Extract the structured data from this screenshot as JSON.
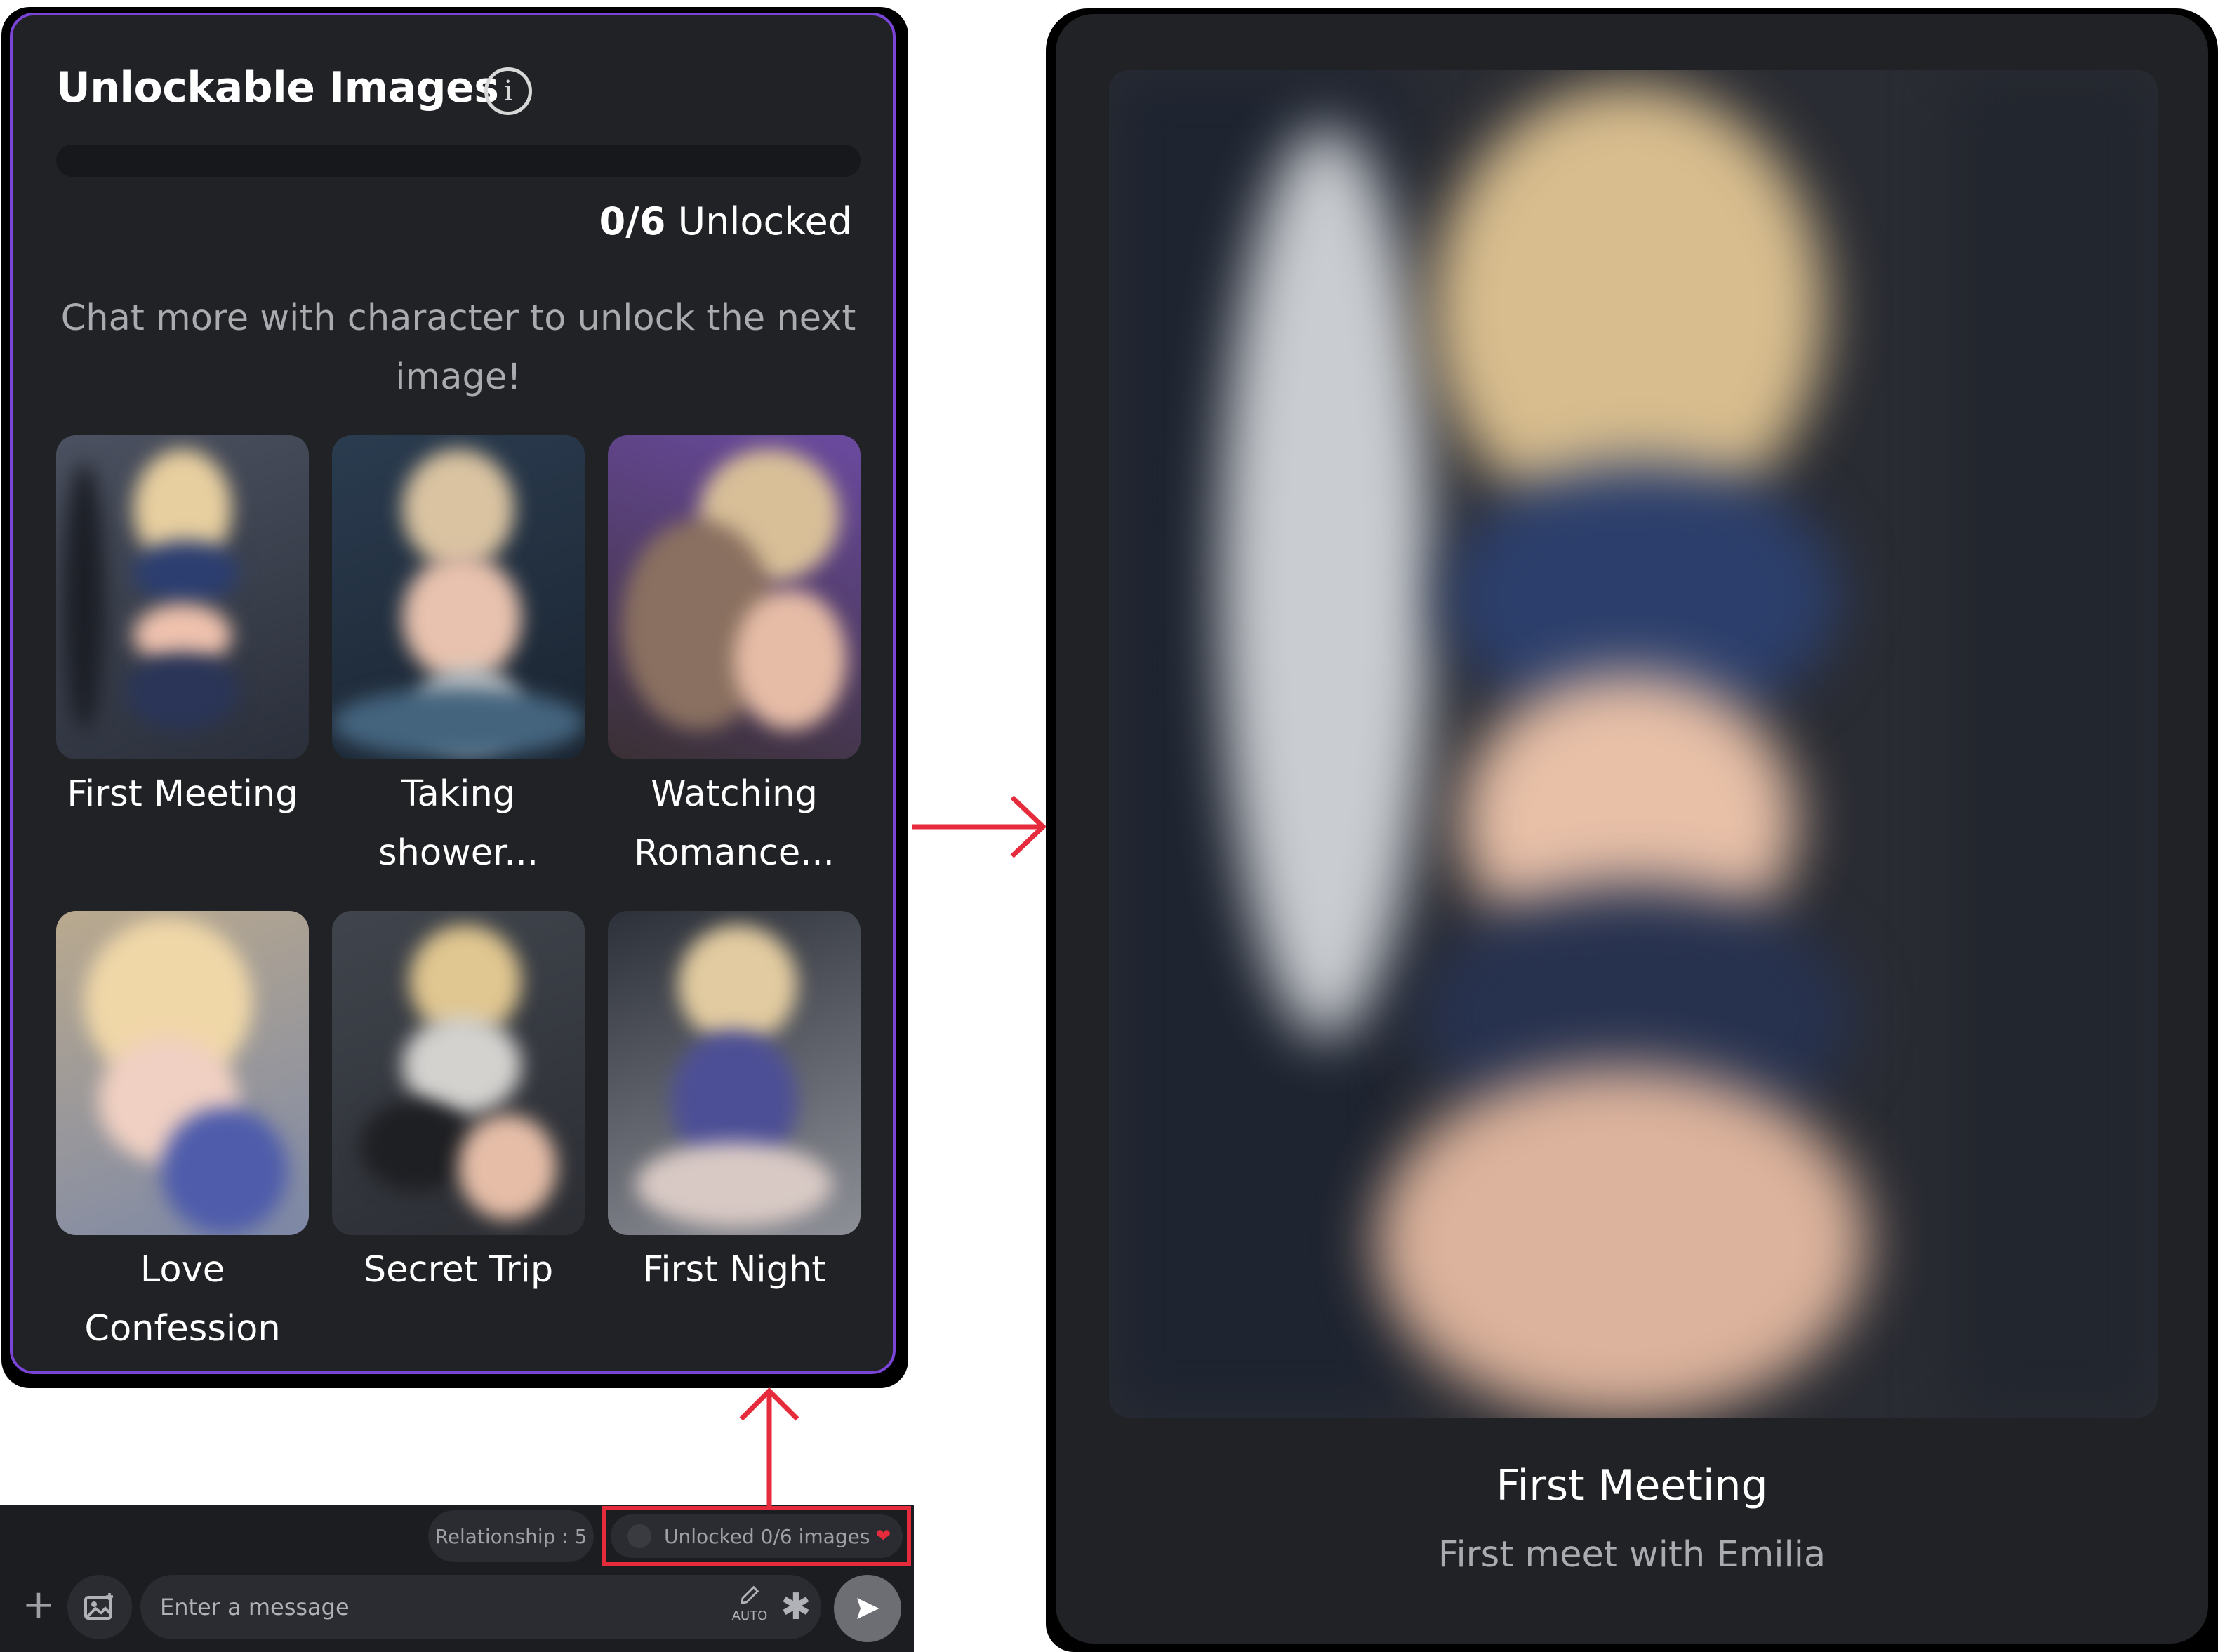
{
  "panel": {
    "title": "Unlockable Images",
    "info_icon": "info-icon",
    "progress": {
      "unlocked": 0,
      "total": 6,
      "fraction": 0
    },
    "unlocked_number": "0/6",
    "unlocked_word": " Unlocked",
    "hint": "Chat more with character to unlock the next image!",
    "images": [
      {
        "label": "First Meeting"
      },
      {
        "label": "Taking shower..."
      },
      {
        "label": "Watching Romance..."
      },
      {
        "label": "Love Confession"
      },
      {
        "label": "Secret Trip"
      },
      {
        "label": "First Night"
      }
    ]
  },
  "chatbar": {
    "relationship": "Relationship : 5",
    "unlocked_chip": "Unlocked 0/6 images",
    "input_placeholder": "Enter a message",
    "auto_label": "AUTO",
    "plus_icon": "plus-icon",
    "image_icon": "image-upload-icon",
    "send_icon": "send-icon"
  },
  "detail": {
    "title": "First Meeting",
    "subtitle": "First meet with Emilia"
  },
  "colors": {
    "accent": "#7a45d6",
    "annotation_red": "#e52b3c",
    "panel_bg": "#212226"
  }
}
